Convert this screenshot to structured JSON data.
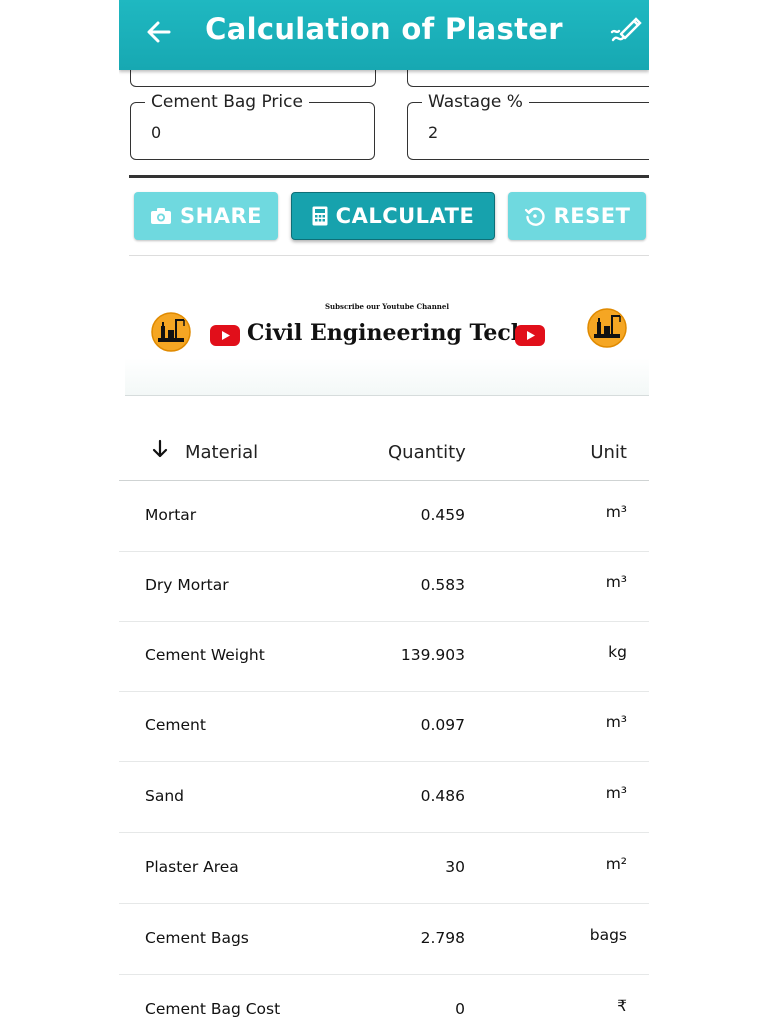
{
  "appbar": {
    "title": "Calculation of Plaster",
    "back_icon": "arrow-left-icon",
    "edit_icon": "pen-icon"
  },
  "fields": {
    "cement_bag_price": {
      "label": "Cement Bag Price",
      "value": "0"
    },
    "wastage": {
      "label": "Wastage %",
      "value": "2"
    }
  },
  "buttons": {
    "share": "SHARE",
    "calculate": "CALCULATE",
    "reset": "RESET"
  },
  "banner": {
    "subtitle": "Subscribe our Youtube Channel",
    "title": "Civil Engineering Tech"
  },
  "table": {
    "headers": [
      "Material",
      "Quantity",
      "Unit"
    ],
    "rows": [
      {
        "material": "Mortar",
        "quantity": "0.459",
        "unit": "m³"
      },
      {
        "material": "Dry Mortar",
        "quantity": "0.583",
        "unit": "m³"
      },
      {
        "material": "Cement Weight",
        "quantity": "139.903",
        "unit": "kg"
      },
      {
        "material": "Cement",
        "quantity": "0.097",
        "unit": "m³"
      },
      {
        "material": "Sand",
        "quantity": "0.486",
        "unit": "m³"
      },
      {
        "material": "Plaster Area",
        "quantity": "30",
        "unit": "m²"
      },
      {
        "material": "Cement Bags",
        "quantity": "2.798",
        "unit": "bags"
      },
      {
        "material": "Cement Bag Cost",
        "quantity": "0",
        "unit": "₹"
      }
    ]
  },
  "colors": {
    "primary": "#17a8b2",
    "button_light": "#6fd9df",
    "button_dark": "#17a2ad",
    "youtube_red": "#e10f1a"
  }
}
